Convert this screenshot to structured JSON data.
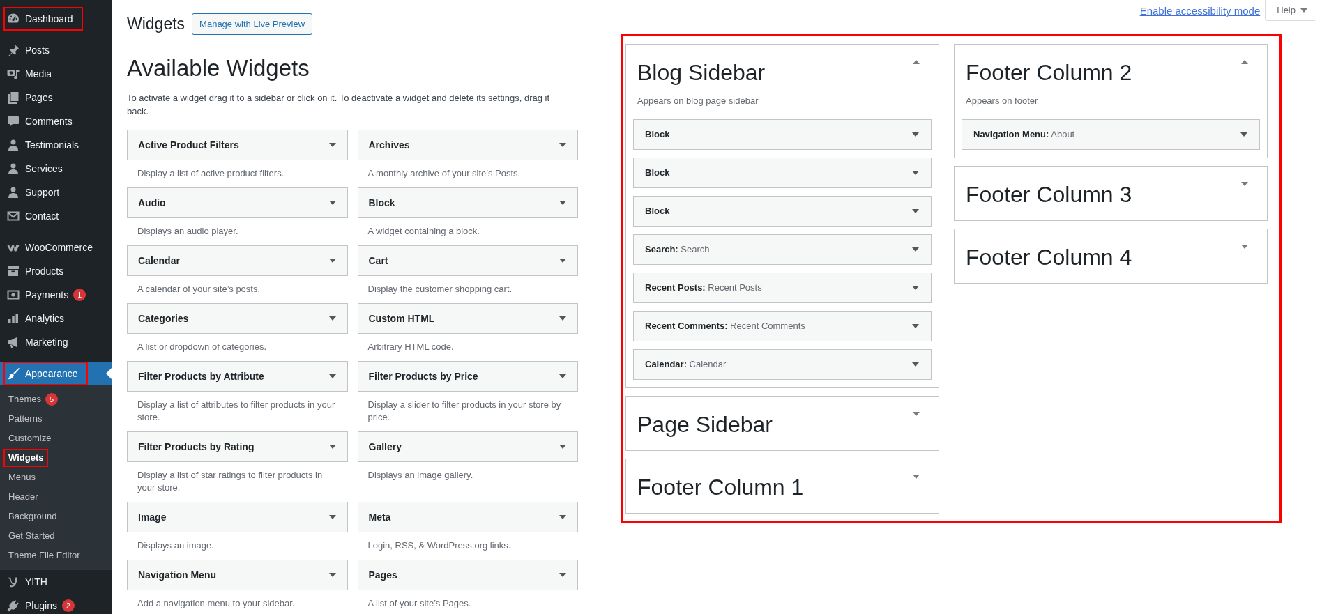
{
  "admin_menu": {
    "groups": [
      {
        "items": [
          {
            "label": "Dashboard",
            "selected": false,
            "annotated": true
          }
        ]
      },
      {
        "items": [
          {
            "label": "Posts",
            "selected": false,
            "annotated": false
          },
          {
            "label": "Media",
            "selected": false,
            "annotated": false
          },
          {
            "label": "Pages",
            "selected": false,
            "annotated": false
          },
          {
            "label": "Comments",
            "selected": false,
            "annotated": false
          },
          {
            "label": "Testimonials",
            "selected": false,
            "annotated": false
          },
          {
            "label": "Services",
            "selected": false,
            "annotated": false
          },
          {
            "label": "Support",
            "selected": false,
            "annotated": false
          },
          {
            "label": "Contact",
            "selected": false,
            "annotated": false
          }
        ]
      },
      {
        "items": [
          {
            "label": "WooCommerce",
            "selected": false,
            "annotated": false
          },
          {
            "label": "Products",
            "selected": false,
            "annotated": false
          },
          {
            "label": "Payments",
            "badge": "1",
            "selected": false,
            "annotated": false
          },
          {
            "label": "Analytics",
            "selected": false,
            "annotated": false
          },
          {
            "label": "Marketing",
            "selected": false,
            "annotated": false
          }
        ]
      },
      {
        "items": [
          {
            "label": "Appearance",
            "selected": true,
            "annotated": true,
            "submenu": [
              {
                "label": "Themes",
                "badge": "5",
                "selected": false,
                "annotated": false
              },
              {
                "label": "Patterns",
                "selected": false,
                "annotated": false
              },
              {
                "label": "Customize",
                "selected": false,
                "annotated": false
              },
              {
                "label": "Widgets",
                "selected": true,
                "annotated": true
              },
              {
                "label": "Menus",
                "selected": false,
                "annotated": false
              },
              {
                "label": "Header",
                "selected": false,
                "annotated": false
              },
              {
                "label": "Background",
                "selected": false,
                "annotated": false
              },
              {
                "label": "Get Started",
                "selected": false,
                "annotated": false
              },
              {
                "label": "Theme File Editor",
                "selected": false,
                "annotated": false
              }
            ]
          },
          {
            "label": "YITH",
            "selected": false,
            "annotated": false
          },
          {
            "label": "Plugins",
            "badge": "2",
            "selected": false,
            "annotated": false
          }
        ]
      }
    ]
  },
  "page_header": {
    "title": "Widgets",
    "action_button": "Manage with Live Preview"
  },
  "screen_links": {
    "accessibility_link": "Enable accessibility mode",
    "help_button": "Help"
  },
  "available_widgets": {
    "heading": "Available Widgets",
    "description": "To activate a widget drag it to a sidebar or click on it. To deactivate a widget and delete its settings, drag it back.",
    "widgets": [
      {
        "title": "Active Product Filters",
        "description": "Display a list of active product filters."
      },
      {
        "title": "Archives",
        "description": "A monthly archive of your site’s Posts."
      },
      {
        "title": "Audio",
        "description": "Displays an audio player."
      },
      {
        "title": "Block",
        "description": "A widget containing a block."
      },
      {
        "title": "Calendar",
        "description": "A calendar of your site’s posts."
      },
      {
        "title": "Cart",
        "description": "Display the customer shopping cart."
      },
      {
        "title": "Categories",
        "description": "A list or dropdown of categories."
      },
      {
        "title": "Custom HTML",
        "description": "Arbitrary HTML code."
      },
      {
        "title": "Filter Products by Attribute",
        "description": "Display a list of attributes to filter products in your store."
      },
      {
        "title": "Filter Products by Price",
        "description": "Display a slider to filter products in your store by price."
      },
      {
        "title": "Filter Products by Rating",
        "description": "Display a list of star ratings to filter products in your store."
      },
      {
        "title": "Gallery",
        "description": "Displays an image gallery."
      },
      {
        "title": "Image",
        "description": "Displays an image."
      },
      {
        "title": "Meta",
        "description": "Login, RSS, & WordPress.org links."
      },
      {
        "title": "Navigation Menu",
        "description": "Add a navigation menu to your sidebar."
      },
      {
        "title": "Pages",
        "description": "A list of your site’s Pages."
      }
    ]
  },
  "widget_areas": {
    "annotated": true,
    "columns": [
      {
        "sidebars": [
          {
            "title": "Blog Sidebar",
            "expanded": true,
            "description": "Appears on blog page sidebar",
            "widgets": [
              {
                "name": "Block"
              },
              {
                "name": "Block"
              },
              {
                "name": "Block"
              },
              {
                "name": "Search:",
                "instance": "Search"
              },
              {
                "name": "Recent Posts:",
                "instance": "Recent Posts"
              },
              {
                "name": "Recent Comments:",
                "instance": "Recent Comments"
              },
              {
                "name": "Calendar:",
                "instance": "Calendar"
              }
            ]
          },
          {
            "title": "Page Sidebar",
            "expanded": false
          },
          {
            "title": "Footer Column 1",
            "expanded": false
          }
        ]
      },
      {
        "sidebars": [
          {
            "title": "Footer Column 2",
            "expanded": true,
            "description": "Appears on footer",
            "widgets": [
              {
                "name": "Navigation Menu:",
                "instance": "About"
              }
            ]
          },
          {
            "title": "Footer Column 3",
            "expanded": false
          },
          {
            "title": "Footer Column 4",
            "expanded": false
          }
        ]
      }
    ]
  }
}
